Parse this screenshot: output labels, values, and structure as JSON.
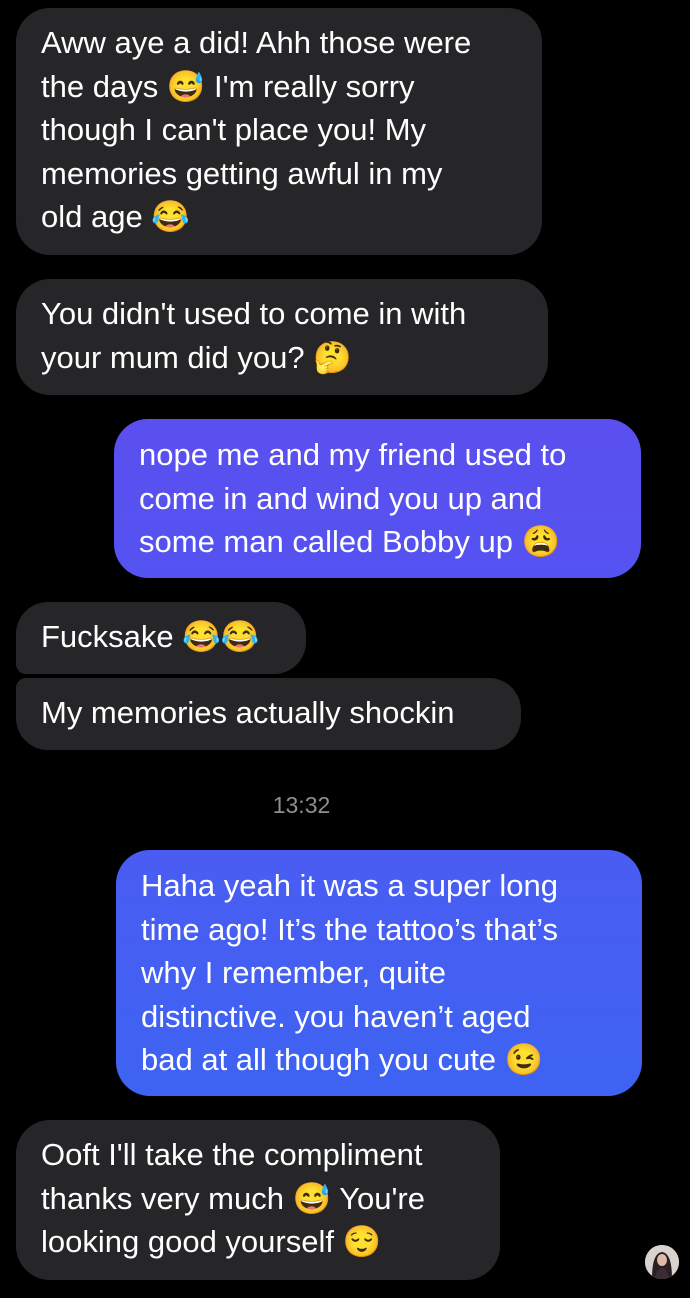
{
  "conversation": {
    "messages": [
      {
        "sender": "them",
        "text": "Aww aye a did! Ahh those were\nthe days 😅 I'm really sorry\nthough I can't place you! My\nmemories getting awful in my\nold age 😂"
      },
      {
        "sender": "them",
        "text": "You didn't used to come in with\nyour mum did you? 🤔"
      },
      {
        "sender": "me",
        "text": "nope me and my friend used to\ncome in and wind you up and\nsome man called Bobby up 😩"
      },
      {
        "sender": "them",
        "text": "Fucksake 😂😂"
      },
      {
        "sender": "them",
        "text": "My memories actually shockin"
      },
      {
        "sender": "me",
        "text": "Haha yeah it was a super long\ntime ago! It’s the tattoo’s that’s\nwhy I remember, quite\ndistinctive. you haven’t aged\nbad at all though you cute 😉"
      },
      {
        "sender": "them",
        "text": "Ooft I'll take the compliment\nthanks very much 😅 You're\nlooking good yourself 😌"
      }
    ],
    "timestamp": "13:32"
  },
  "colors": {
    "background": "#000000",
    "received_bubble": "#262628",
    "sent_gradient_top": "#5b4ff0",
    "sent_gradient_bottom": "#3d63f2",
    "text": "#ffffff",
    "timestamp": "#8e8e93"
  },
  "avatar": {
    "icon": "profile-avatar-icon"
  }
}
